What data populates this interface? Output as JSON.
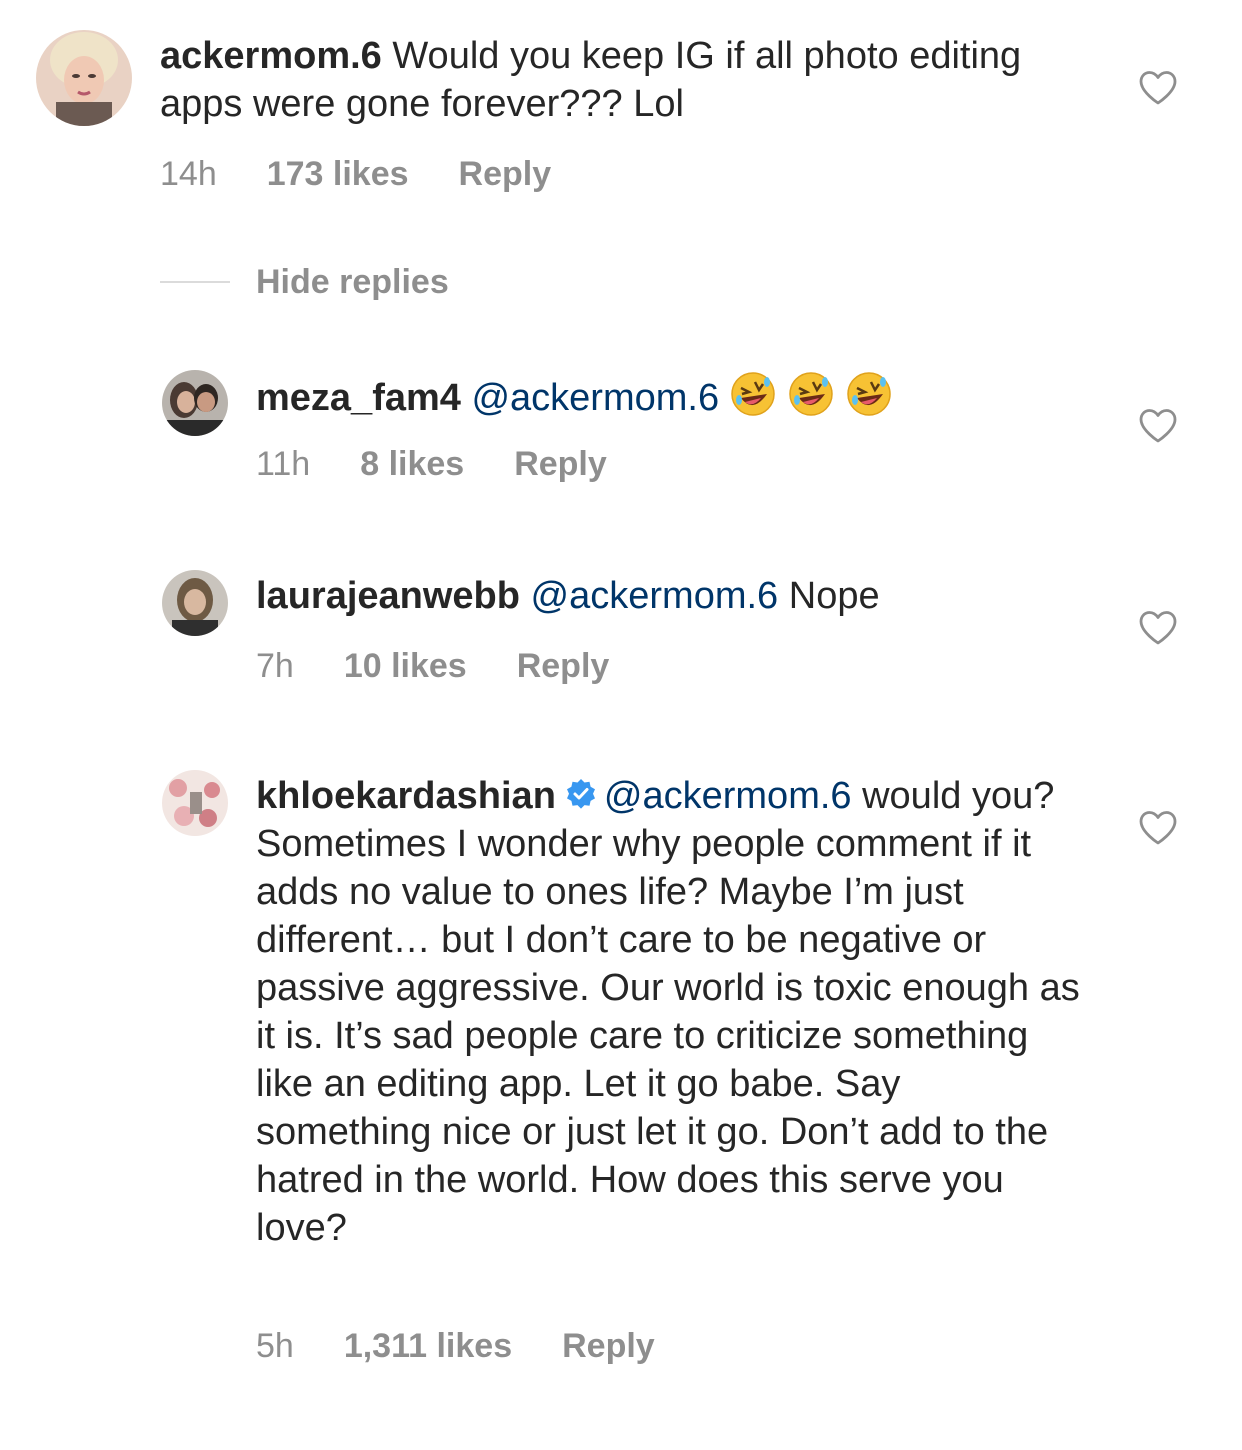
{
  "comment": {
    "username": "ackermom.6",
    "text": "Would you keep IG if all photo editing apps were gone forever??? Lol",
    "time": "14h",
    "likes": "173 likes",
    "reply": "Reply",
    "like_icon": "heart-outline-icon"
  },
  "hide_replies_label": "Hide replies",
  "replies": [
    {
      "username": "meza_fam4",
      "mention": "@ackermom.6",
      "emoji": "rolling-on-floor-laughing-emoji",
      "time": "11h",
      "likes": "8 likes",
      "reply": "Reply"
    },
    {
      "username": "laurajeanwebb",
      "mention": "@ackermom.6",
      "text": "Nope",
      "time": "7h",
      "likes": "10 likes",
      "reply": "Reply"
    },
    {
      "username": "khloekardashian",
      "verified_icon": "verified-badge-icon",
      "mention": "@ackermom.6",
      "text": "would you? Sometimes I wonder why people comment if it adds no value to ones life? Maybe I’m just different… but I don’t care to be negative or passive aggressive. Our world is toxic enough as it is. It’s sad people care to criticize something like an editing app. Let it go babe. Say something nice or just let it go. Don’t add to the hatred in the world. How does this serve you love?",
      "time": "5h",
      "likes": "1,311 likes",
      "reply": "Reply"
    }
  ],
  "colors": {
    "text": "#262626",
    "secondary": "#8e8e8e",
    "mention": "#003569",
    "verified": "#3897f0"
  }
}
